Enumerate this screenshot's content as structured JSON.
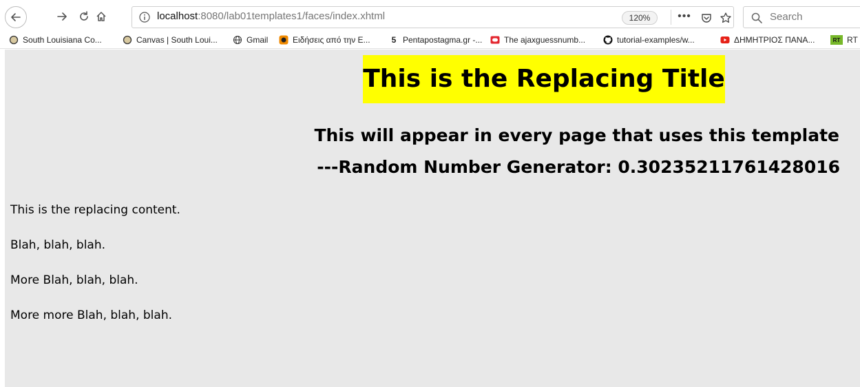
{
  "browser": {
    "url_host": "localhost",
    "url_rest": ":8080/lab01templates1/faces/index.xhtml",
    "zoom": "120%",
    "more_glyph": "•••",
    "search_placeholder": "Search"
  },
  "bookmarks": [
    {
      "label": "South Louisiana Co...",
      "icon": "circle-icon"
    },
    {
      "label": "Canvas | South Loui...",
      "icon": "circle-icon"
    },
    {
      "label": "Gmail",
      "icon": "globe-icon"
    },
    {
      "label": "Ειδήσεις από την Ε...",
      "icon": "orange-badge-icon"
    },
    {
      "label": "Pentapostagma.gr -...",
      "icon": "five-icon"
    },
    {
      "label": "The ajaxguessnumb...",
      "icon": "red-rect-icon"
    },
    {
      "label": "tutorial-examples/w...",
      "icon": "github-icon"
    },
    {
      "label": "ΔΗΜΗΤΡΙΟΣ ΠΑΝΑ...",
      "icon": "youtube-icon"
    },
    {
      "label": "RT",
      "icon": "rt-icon",
      "badge": "RT"
    }
  ],
  "page": {
    "title": "This is the Replacing Title",
    "template_line": "This will appear in every page that uses this template",
    "random_line": "---Random Number Generator: 0.30235211761428016",
    "paragraphs": [
      "This is the replacing content.",
      "Blah, blah, blah.",
      "More Blah, blah, blah.",
      "More more Blah, blah, blah."
    ]
  },
  "colors": {
    "title_highlight": "#ffff00",
    "page_background": "#e8e8e8"
  }
}
